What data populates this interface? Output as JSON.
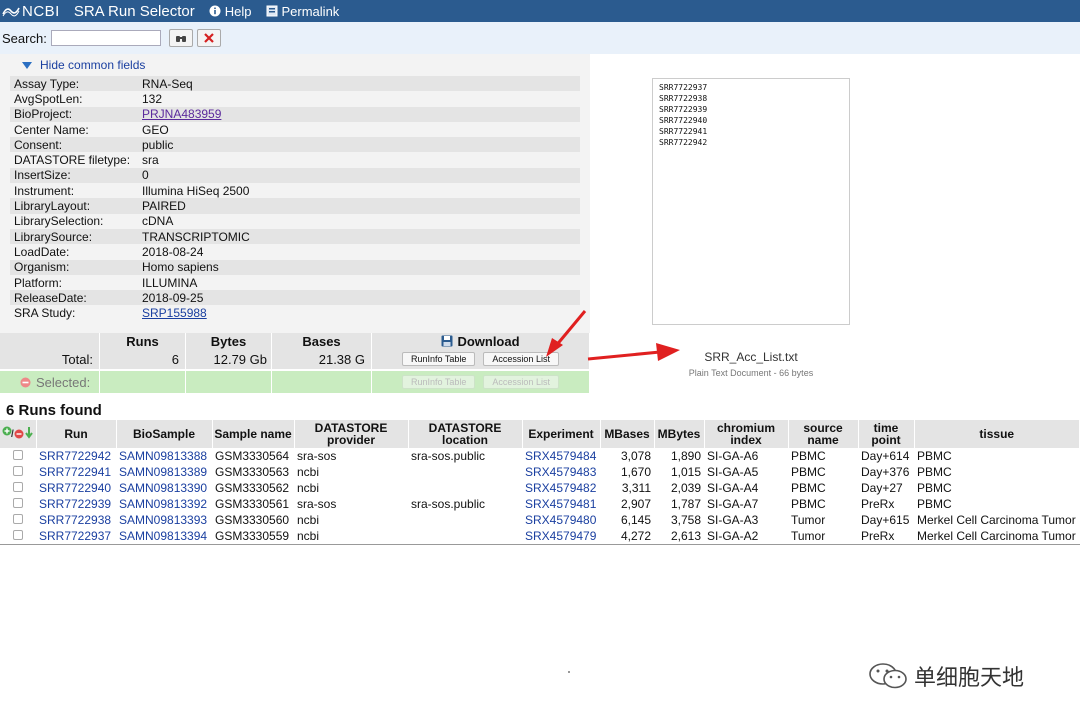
{
  "header": {
    "logo": "NCBI",
    "title": "SRA Run Selector",
    "help": "Help",
    "permalink": "Permalink"
  },
  "search": {
    "label": "Search:",
    "value": "",
    "placeholder": ""
  },
  "common": {
    "toggle": "Hide common fields",
    "fields": [
      {
        "key": "Assay Type:",
        "value": "RNA-Seq"
      },
      {
        "key": "AvgSpotLen:",
        "value": "132"
      },
      {
        "key": "BioProject:",
        "value": "PRJNA483959",
        "link": "visited"
      },
      {
        "key": "Center Name:",
        "value": "GEO"
      },
      {
        "key": "Consent:",
        "value": "public"
      },
      {
        "key": "DATASTORE filetype:",
        "value": "sra"
      },
      {
        "key": "InsertSize:",
        "value": "0"
      },
      {
        "key": "Instrument:",
        "value": "Illumina HiSeq 2500"
      },
      {
        "key": "LibraryLayout:",
        "value": "PAIRED"
      },
      {
        "key": "LibrarySelection:",
        "value": "cDNA"
      },
      {
        "key": "LibrarySource:",
        "value": "TRANSCRIPTOMIC"
      },
      {
        "key": "LoadDate:",
        "value": "2018-08-24"
      },
      {
        "key": "Organism:",
        "value": "Homo sapiens"
      },
      {
        "key": "Platform:",
        "value": "ILLUMINA"
      },
      {
        "key": "ReleaseDate:",
        "value": "2018-09-25"
      },
      {
        "key": "SRA Study:",
        "value": "SRP155988",
        "link": "link"
      }
    ]
  },
  "totals": {
    "headers": {
      "runs": "Runs",
      "bytes": "Bytes",
      "bases": "Bases",
      "download": "Download"
    },
    "total": {
      "label": "Total:",
      "runs": "6",
      "bytes": "12.79 Gb",
      "bases": "21.38 G"
    },
    "selected": {
      "label": "Selected:"
    },
    "buttons": {
      "runinfo": "RunInfo Table",
      "accession": "Accession List"
    }
  },
  "preview": {
    "lines": [
      "SRR7722937",
      "SRR7722938",
      "SRR7722939",
      "SRR7722940",
      "SRR7722941",
      "SRR7722942"
    ],
    "filename": "SRR_Acc_List.txt",
    "meta": "Plain Text Document - 66 bytes"
  },
  "runs": {
    "found": "6 Runs found",
    "columns": [
      "Run",
      "BioSample",
      "Sample name",
      "DATASTORE provider",
      "DATASTORE location",
      "Experiment",
      "MBases",
      "MBytes",
      "chromium index",
      "source name",
      "time point",
      "tissue"
    ],
    "rows": [
      [
        "SRR7722942",
        "SAMN09813388",
        "GSM3330564",
        "sra-sos",
        "sra-sos.public",
        "SRX4579484",
        "3,078",
        "1,890",
        "SI-GA-A6",
        "PBMC",
        "Day+614",
        "PBMC"
      ],
      [
        "SRR7722941",
        "SAMN09813389",
        "GSM3330563",
        "ncbi",
        "",
        "SRX4579483",
        "1,670",
        "1,015",
        "SI-GA-A5",
        "PBMC",
        "Day+376",
        "PBMC"
      ],
      [
        "SRR7722940",
        "SAMN09813390",
        "GSM3330562",
        "ncbi",
        "",
        "SRX4579482",
        "3,311",
        "2,039",
        "SI-GA-A4",
        "PBMC",
        "Day+27",
        "PBMC"
      ],
      [
        "SRR7722939",
        "SAMN09813392",
        "GSM3330561",
        "sra-sos",
        "sra-sos.public",
        "SRX4579481",
        "2,907",
        "1,787",
        "SI-GA-A7",
        "PBMC",
        "PreRx",
        "PBMC"
      ],
      [
        "SRR7722938",
        "SAMN09813393",
        "GSM3330560",
        "ncbi",
        "",
        "SRX4579480",
        "6,145",
        "3,758",
        "SI-GA-A3",
        "Tumor",
        "Day+615",
        "Merkel Cell Carcinoma Tumor"
      ],
      [
        "SRR7722937",
        "SAMN09813394",
        "GSM3330559",
        "ncbi",
        "",
        "SRX4579479",
        "4,272",
        "2,613",
        "SI-GA-A2",
        "Tumor",
        "PreRx",
        "Merkel Cell Carcinoma Tumor"
      ]
    ]
  },
  "watermark": "单细胞天地",
  "colors": {
    "header_bg": "#2b5b8f",
    "link": "#1a3fa0",
    "visited": "#5b2a9c",
    "selected_bg": "#c9ecc0",
    "arrow": "#e02020"
  }
}
